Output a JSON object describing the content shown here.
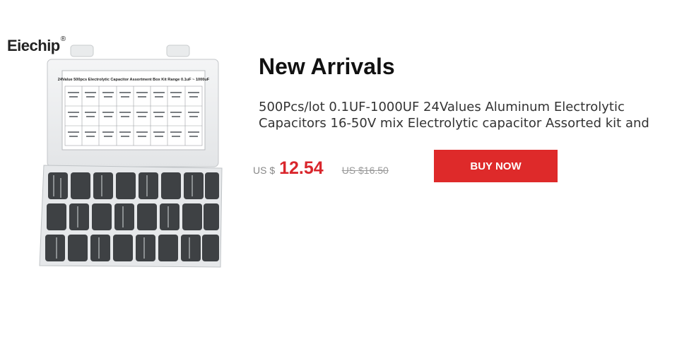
{
  "brand": {
    "name": "Eiechip",
    "mark": "®"
  },
  "product": {
    "image_label": "24Value 500pcs Electrolytic Capacitor Assortment Box Kit Range 0.1uF ~ 1000uF",
    "heading": "New Arrivals",
    "description_line1": "500Pcs/lot 0.1UF-1000UF 24Values Aluminum Electrolytic",
    "description_line2": "Capacitors 16-50V mix Electrolytic capacitor Assorted kit and",
    "currency": "US $",
    "price": "12.54",
    "old_price": "US $16.50",
    "buy_label": "BUY NOW"
  },
  "colors": {
    "accent": "#de2a2a",
    "price": "#d9262c"
  }
}
